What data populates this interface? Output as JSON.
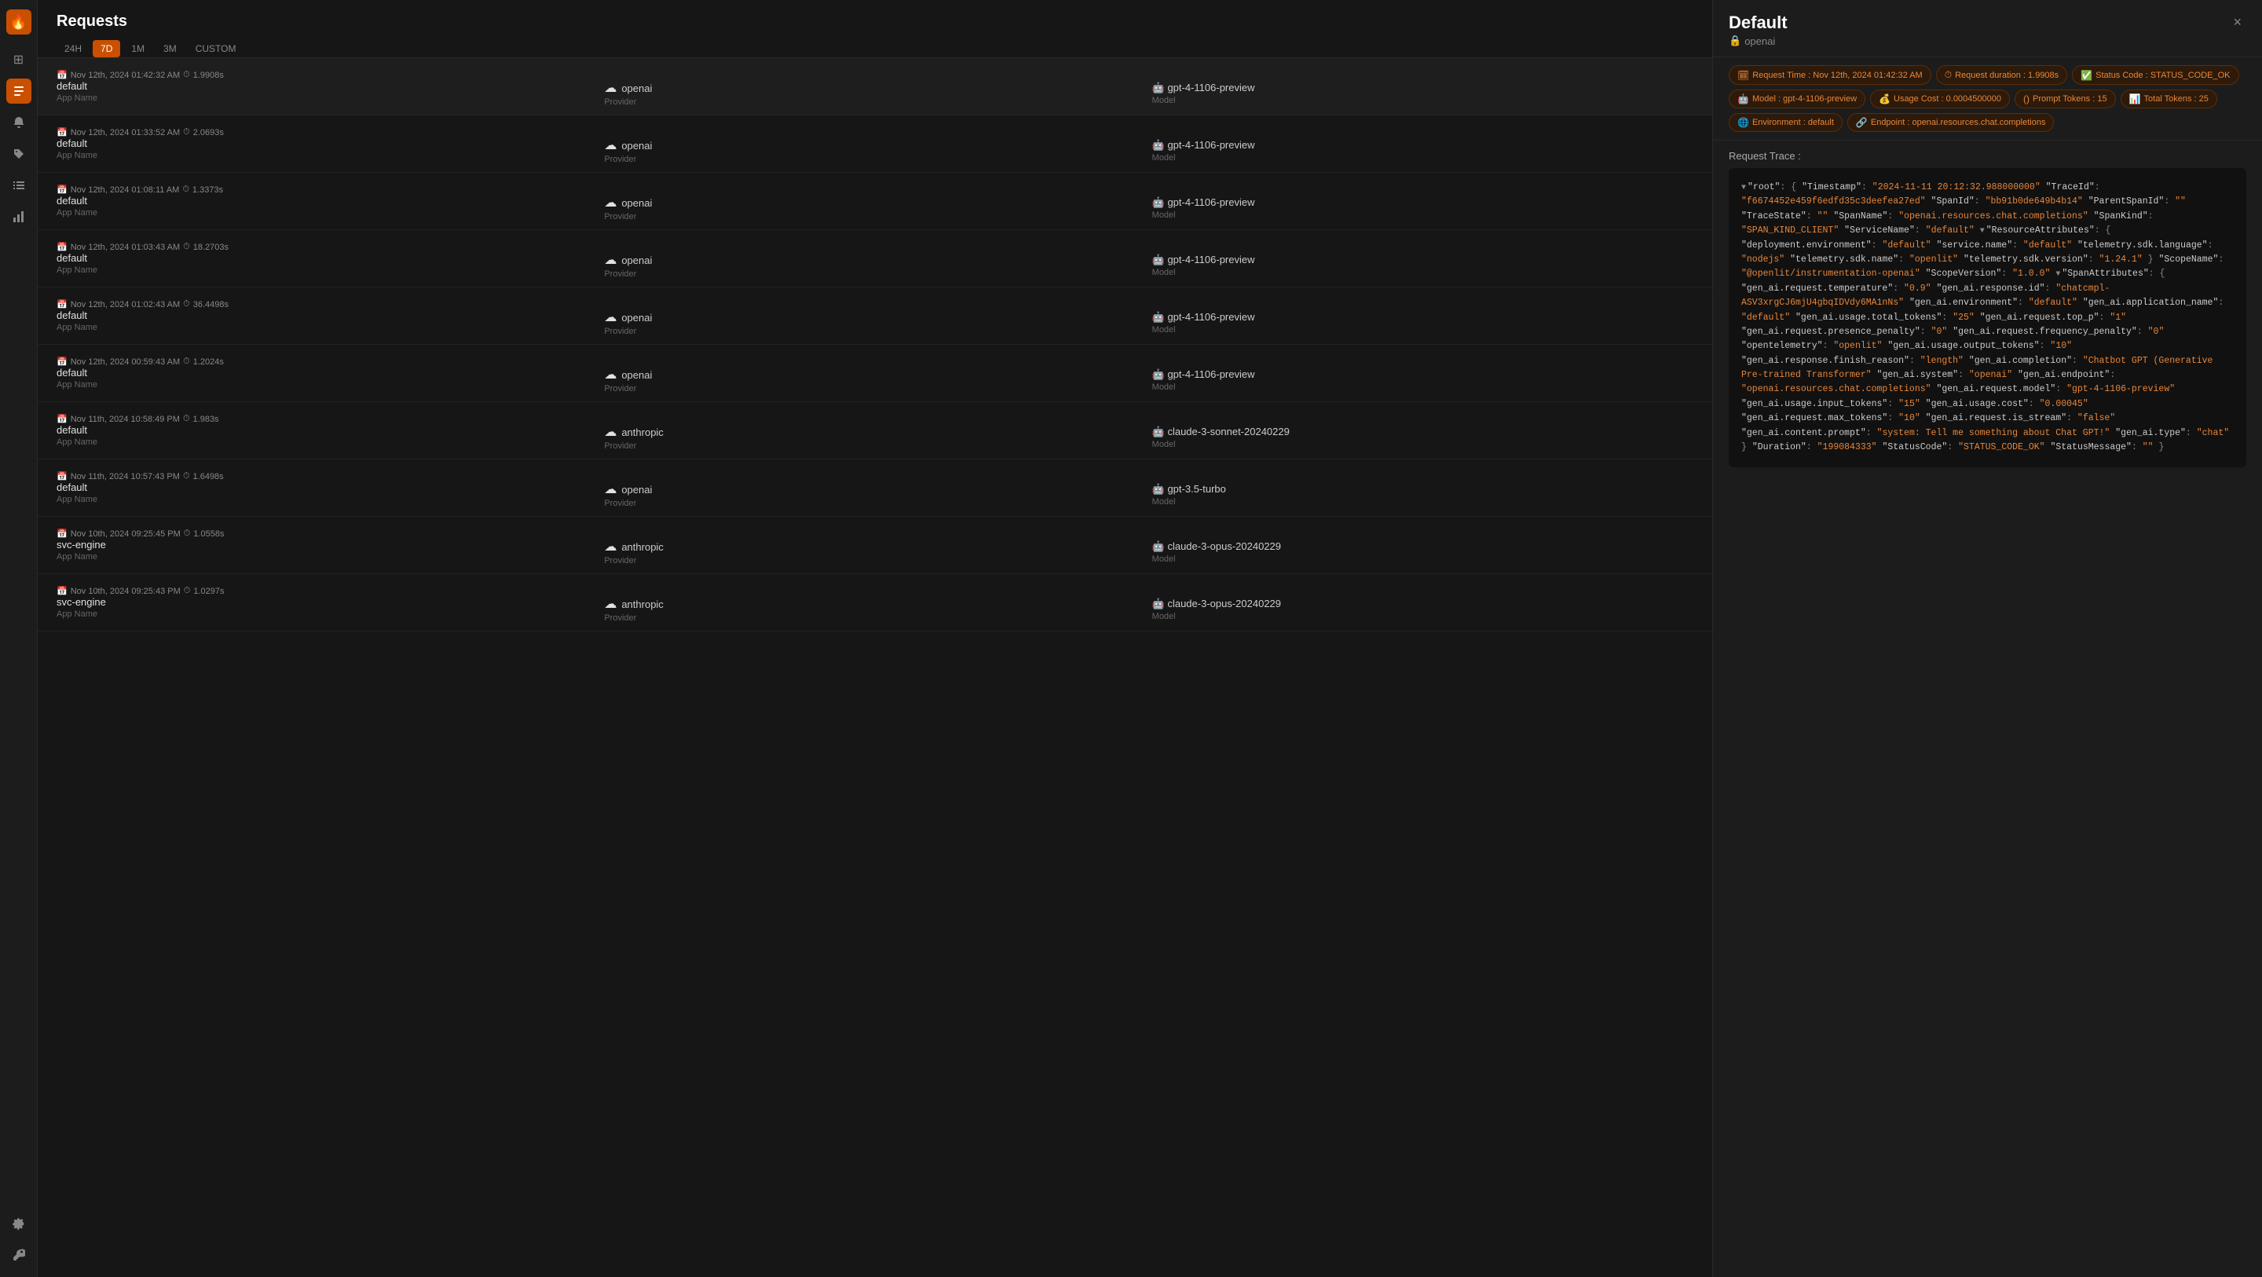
{
  "sidebar": {
    "logo": "🔥",
    "icons": [
      {
        "name": "dashboard-icon",
        "glyph": "⊞",
        "active": false
      },
      {
        "name": "requests-icon",
        "glyph": "📋",
        "active": true
      },
      {
        "name": "alerts-icon",
        "glyph": "🔔",
        "active": false
      },
      {
        "name": "tags-icon",
        "glyph": "🏷",
        "active": false
      },
      {
        "name": "list-icon",
        "glyph": "☰",
        "active": false
      },
      {
        "name": "chart-icon",
        "glyph": "📊",
        "active": false
      },
      {
        "name": "settings-icon",
        "glyph": "⚙",
        "active": false
      },
      {
        "name": "key-icon",
        "glyph": "🔑",
        "active": false
      }
    ]
  },
  "header": {
    "title": "Requests",
    "time_filters": [
      "24H",
      "7D",
      "1M",
      "3M",
      "CUSTOM"
    ],
    "active_filter": "7D"
  },
  "requests": [
    {
      "date": "Nov 12th, 2024 01:42:32 AM",
      "duration": "1.9908s",
      "name": "default",
      "app_name_label": "App Name",
      "provider": "openai",
      "provider_label": "Provider",
      "model": "gpt-4-1106-preview",
      "model_label": "Model",
      "selected": true
    },
    {
      "date": "Nov 12th, 2024 01:33:52 AM",
      "duration": "2.0693s",
      "name": "default",
      "app_name_label": "App Name",
      "provider": "openai",
      "provider_label": "Provider",
      "model": "gpt-4-1106-preview",
      "model_label": "Model",
      "selected": false
    },
    {
      "date": "Nov 12th, 2024 01:08:11 AM",
      "duration": "1.3373s",
      "name": "default",
      "app_name_label": "App Name",
      "provider": "openai",
      "provider_label": "Provider",
      "model": "gpt-4-1106-preview",
      "model_label": "Model",
      "selected": false
    },
    {
      "date": "Nov 12th, 2024 01:03:43 AM",
      "duration": "18.2703s",
      "name": "default",
      "app_name_label": "App Name",
      "provider": "openai",
      "provider_label": "Provider",
      "model": "gpt-4-1106-preview",
      "model_label": "Model",
      "selected": false
    },
    {
      "date": "Nov 12th, 2024 01:02:43 AM",
      "duration": "36.4498s",
      "name": "default",
      "app_name_label": "App Name",
      "provider": "openai",
      "provider_label": "Provider",
      "model": "gpt-4-1106-preview",
      "model_label": "Model",
      "selected": false
    },
    {
      "date": "Nov 12th, 2024 00:59:43 AM",
      "duration": "1.2024s",
      "name": "default",
      "app_name_label": "App Name",
      "provider": "openai",
      "provider_label": "Provider",
      "model": "gpt-4-1106-preview",
      "model_label": "Model",
      "selected": false
    },
    {
      "date": "Nov 11th, 2024 10:58:49 PM",
      "duration": "1.983s",
      "name": "default",
      "app_name_label": "App Name",
      "provider": "anthropic",
      "provider_label": "Provider",
      "model": "claude-3-sonnet-20240229",
      "model_label": "Model",
      "selected": false
    },
    {
      "date": "Nov 11th, 2024 10:57:43 PM",
      "duration": "1.6498s",
      "name": "default",
      "app_name_label": "App Name",
      "provider": "openai",
      "provider_label": "Provider",
      "model": "gpt-3.5-turbo",
      "model_label": "Model",
      "selected": false
    },
    {
      "date": "Nov 10th, 2024 09:25:45 PM",
      "duration": "1.0558s",
      "name": "svc-engine",
      "app_name_label": "App Name",
      "provider": "anthropic",
      "provider_label": "Provider",
      "model": "claude-3-opus-20240229",
      "model_label": "Model",
      "selected": false
    },
    {
      "date": "Nov 10th, 2024 09:25:43 PM",
      "duration": "1.0297s",
      "name": "svc-engine",
      "app_name_label": "App Name",
      "provider": "anthropic",
      "provider_label": "Provider",
      "model": "claude-3-opus-20240229",
      "model_label": "Model",
      "selected": false
    }
  ],
  "detail": {
    "title": "Default",
    "subtitle_icon": "🔒",
    "subtitle": "openai",
    "close_label": "×",
    "badges": [
      {
        "icon": "🗓",
        "text": "Request Time : Nov 12th, 2024 01:42:32 AM"
      },
      {
        "icon": "⏱",
        "text": "Request duration : 1.9908s"
      },
      {
        "icon": "✅",
        "text": "Status Code : STATUS_CODE_OK"
      },
      {
        "icon": "🤖",
        "text": "Model : gpt-4-1106-preview"
      },
      {
        "icon": "💰",
        "text": "Usage Cost : 0.0004500000"
      },
      {
        "icon": "()",
        "text": "Prompt Tokens : 15"
      },
      {
        "icon": "📊",
        "text": "Total Tokens : 25"
      },
      {
        "icon": "🌐",
        "text": "Environment : default"
      },
      {
        "icon": "🔗",
        "text": "Endpoint : openai.resources.chat.completions"
      }
    ],
    "trace_label": "Request Trace :",
    "trace_json": {
      "root": {
        "Timestamp": "2024-11-11 20:12:32.988000000",
        "TraceId": "f6674452e459f6edfd35c3deefea27ed",
        "SpanId": "bb91b0de649b4b14",
        "ParentSpanId": "",
        "TraceState": "",
        "SpanName": "openai.resources.chat.completions",
        "SpanKind": "SPAN_KIND_CLIENT",
        "ServiceName": "default",
        "ResourceAttributes": {
          "deployment.environment": "default",
          "service.name": "default",
          "telemetry.sdk.language": "nodejs",
          "telemetry.sdk.name": "openlit",
          "telemetry.sdk.version": "1.24.1"
        },
        "ScopeName": "@openlit/instrumentation-openai",
        "ScopeVersion": "1.0.0",
        "SpanAttributes": {
          "gen_ai.request.temperature": "0.9",
          "gen_ai.response.id": "chatcmpl-ASV3xrgCJ6mjU4gbqIDVdy6MA1nNs",
          "gen_ai.environment": "default",
          "gen_ai.application_name": "default",
          "gen_ai.usage.total_tokens": "25",
          "gen_ai.request.top_p": "1",
          "gen_ai.request.presence_penalty": "0",
          "gen_ai.request.frequency_penalty": "0",
          "opentelemetry": "openlit",
          "gen_ai.usage.output_tokens": "10",
          "gen_ai.response.finish_reason": "length",
          "gen_ai.completion": "Chatbot GPT (Generative Pre-trained Transformer",
          "gen_ai.system": "openai",
          "gen_ai.endpoint": "openai.resources.chat.completions",
          "gen_ai.request.model": "gpt-4-1106-preview",
          "gen_ai.usage.input_tokens": "15",
          "gen_ai.usage.cost": "0.00045",
          "gen_ai.request.max_tokens": "10",
          "gen_ai.request.is_stream": "false",
          "gen_ai.content.prompt": "system: Tell me something about Chat GPT!",
          "gen_ai.type": "chat"
        },
        "Duration": "199084333",
        "StatusCode": "STATUS_CODE_OK",
        "StatusMessage": ""
      }
    }
  }
}
